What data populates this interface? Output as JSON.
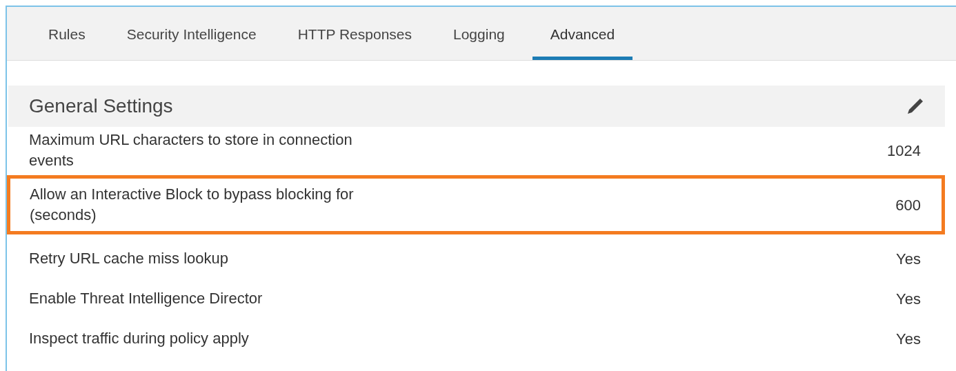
{
  "tabs": [
    {
      "label": "Rules",
      "selected": false
    },
    {
      "label": "Security Intelligence",
      "selected": false
    },
    {
      "label": "HTTP Responses",
      "selected": false
    },
    {
      "label": "Logging",
      "selected": false
    },
    {
      "label": "Advanced",
      "selected": true
    }
  ],
  "section": {
    "title": "General Settings"
  },
  "settings": [
    {
      "label": "Maximum URL characters to store in connection events",
      "value": "1024",
      "highlighted": false
    },
    {
      "label": "Allow an Interactive Block to bypass blocking for (seconds)",
      "value": "600",
      "highlighted": true
    },
    {
      "label": "Retry URL cache miss lookup",
      "value": "Yes",
      "highlighted": false
    },
    {
      "label": "Enable Threat Intelligence Director",
      "value": "Yes",
      "highlighted": false
    },
    {
      "label": "Inspect traffic during policy apply",
      "value": "Yes",
      "highlighted": false
    }
  ]
}
